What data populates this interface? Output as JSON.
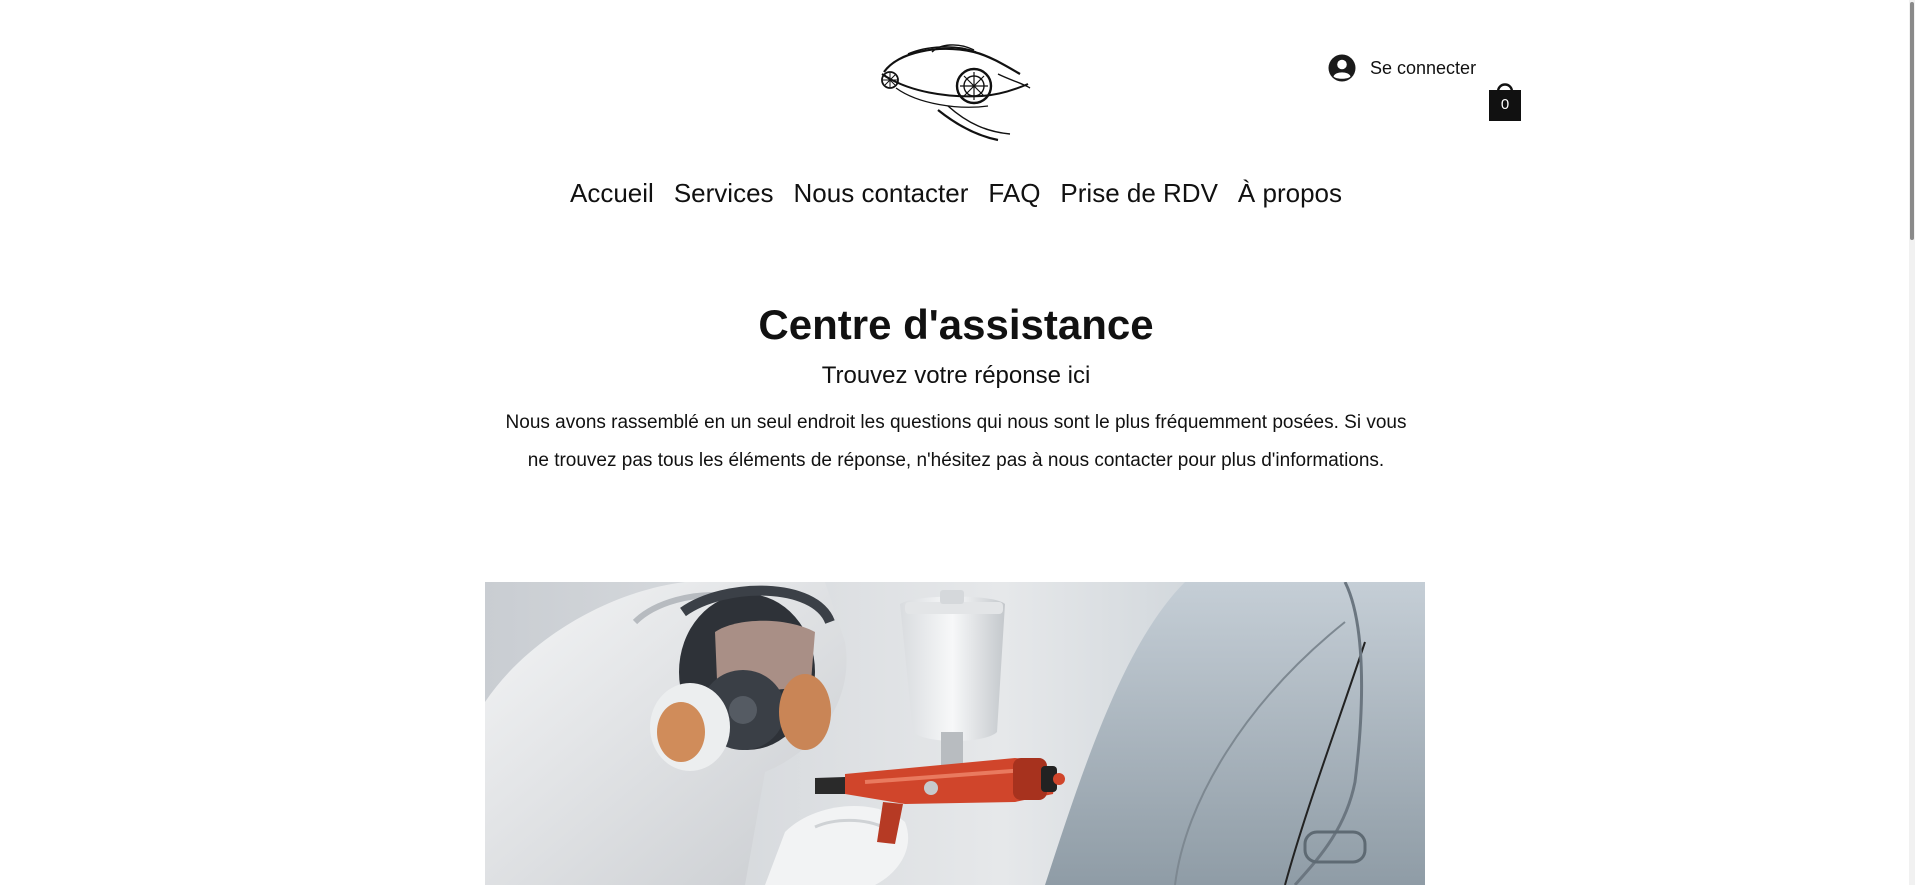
{
  "header": {
    "logo_icon": "sports-car-logo-icon",
    "login_icon": "user-avatar-icon",
    "login_label": "Se connecter",
    "cart_icon": "shopping-bag-icon",
    "cart_count": "0"
  },
  "nav": {
    "items": [
      {
        "label": "Accueil"
      },
      {
        "label": "Services"
      },
      {
        "label": "Nous contacter"
      },
      {
        "label": "FAQ"
      },
      {
        "label": "Prise de RDV"
      },
      {
        "label": "À propos"
      }
    ]
  },
  "main": {
    "title": "Centre d'assistance",
    "subtitle": "Trouvez votre réponse ici",
    "intro": "Nous avons rassemblé en un seul endroit les questions qui nous sont le plus fréquemment posées. Si vous ne trouvez pas tous les éléments de réponse, n'hésitez pas à nous contacter pour plus d'informations."
  },
  "hero": {
    "image": "car-painter-spray-gun-photo"
  },
  "colors": {
    "text": "#111111",
    "background": "#ffffff",
    "accent_spray_gun": "#d0452b"
  }
}
